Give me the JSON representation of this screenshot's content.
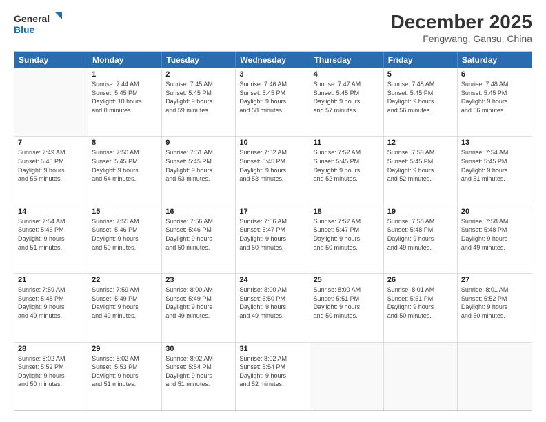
{
  "header": {
    "logo_line1": "General",
    "logo_line2": "Blue",
    "title": "December 2025",
    "subtitle": "Fengwang, Gansu, China"
  },
  "weekdays": [
    "Sunday",
    "Monday",
    "Tuesday",
    "Wednesday",
    "Thursday",
    "Friday",
    "Saturday"
  ],
  "weeks": [
    [
      {
        "day": "",
        "info": ""
      },
      {
        "day": "1",
        "info": "Sunrise: 7:44 AM\nSunset: 5:45 PM\nDaylight: 10 hours\nand 0 minutes."
      },
      {
        "day": "2",
        "info": "Sunrise: 7:45 AM\nSunset: 5:45 PM\nDaylight: 9 hours\nand 59 minutes."
      },
      {
        "day": "3",
        "info": "Sunrise: 7:46 AM\nSunset: 5:45 PM\nDaylight: 9 hours\nand 58 minutes."
      },
      {
        "day": "4",
        "info": "Sunrise: 7:47 AM\nSunset: 5:45 PM\nDaylight: 9 hours\nand 57 minutes."
      },
      {
        "day": "5",
        "info": "Sunrise: 7:48 AM\nSunset: 5:45 PM\nDaylight: 9 hours\nand 56 minutes."
      },
      {
        "day": "6",
        "info": "Sunrise: 7:48 AM\nSunset: 5:45 PM\nDaylight: 9 hours\nand 56 minutes."
      }
    ],
    [
      {
        "day": "7",
        "info": "Sunrise: 7:49 AM\nSunset: 5:45 PM\nDaylight: 9 hours\nand 55 minutes."
      },
      {
        "day": "8",
        "info": "Sunrise: 7:50 AM\nSunset: 5:45 PM\nDaylight: 9 hours\nand 54 minutes."
      },
      {
        "day": "9",
        "info": "Sunrise: 7:51 AM\nSunset: 5:45 PM\nDaylight: 9 hours\nand 53 minutes."
      },
      {
        "day": "10",
        "info": "Sunrise: 7:52 AM\nSunset: 5:45 PM\nDaylight: 9 hours\nand 53 minutes."
      },
      {
        "day": "11",
        "info": "Sunrise: 7:52 AM\nSunset: 5:45 PM\nDaylight: 9 hours\nand 52 minutes."
      },
      {
        "day": "12",
        "info": "Sunrise: 7:53 AM\nSunset: 5:45 PM\nDaylight: 9 hours\nand 52 minutes."
      },
      {
        "day": "13",
        "info": "Sunrise: 7:54 AM\nSunset: 5:45 PM\nDaylight: 9 hours\nand 51 minutes."
      }
    ],
    [
      {
        "day": "14",
        "info": "Sunrise: 7:54 AM\nSunset: 5:46 PM\nDaylight: 9 hours\nand 51 minutes."
      },
      {
        "day": "15",
        "info": "Sunrise: 7:55 AM\nSunset: 5:46 PM\nDaylight: 9 hours\nand 50 minutes."
      },
      {
        "day": "16",
        "info": "Sunrise: 7:56 AM\nSunset: 5:46 PM\nDaylight: 9 hours\nand 50 minutes."
      },
      {
        "day": "17",
        "info": "Sunrise: 7:56 AM\nSunset: 5:47 PM\nDaylight: 9 hours\nand 50 minutes."
      },
      {
        "day": "18",
        "info": "Sunrise: 7:57 AM\nSunset: 5:47 PM\nDaylight: 9 hours\nand 50 minutes."
      },
      {
        "day": "19",
        "info": "Sunrise: 7:58 AM\nSunset: 5:48 PM\nDaylight: 9 hours\nand 49 minutes."
      },
      {
        "day": "20",
        "info": "Sunrise: 7:58 AM\nSunset: 5:48 PM\nDaylight: 9 hours\nand 49 minutes."
      }
    ],
    [
      {
        "day": "21",
        "info": "Sunrise: 7:59 AM\nSunset: 5:48 PM\nDaylight: 9 hours\nand 49 minutes."
      },
      {
        "day": "22",
        "info": "Sunrise: 7:59 AM\nSunset: 5:49 PM\nDaylight: 9 hours\nand 49 minutes."
      },
      {
        "day": "23",
        "info": "Sunrise: 8:00 AM\nSunset: 5:49 PM\nDaylight: 9 hours\nand 49 minutes."
      },
      {
        "day": "24",
        "info": "Sunrise: 8:00 AM\nSunset: 5:50 PM\nDaylight: 9 hours\nand 49 minutes."
      },
      {
        "day": "25",
        "info": "Sunrise: 8:00 AM\nSunset: 5:51 PM\nDaylight: 9 hours\nand 50 minutes."
      },
      {
        "day": "26",
        "info": "Sunrise: 8:01 AM\nSunset: 5:51 PM\nDaylight: 9 hours\nand 50 minutes."
      },
      {
        "day": "27",
        "info": "Sunrise: 8:01 AM\nSunset: 5:52 PM\nDaylight: 9 hours\nand 50 minutes."
      }
    ],
    [
      {
        "day": "28",
        "info": "Sunrise: 8:02 AM\nSunset: 5:52 PM\nDaylight: 9 hours\nand 50 minutes."
      },
      {
        "day": "29",
        "info": "Sunrise: 8:02 AM\nSunset: 5:53 PM\nDaylight: 9 hours\nand 51 minutes."
      },
      {
        "day": "30",
        "info": "Sunrise: 8:02 AM\nSunset: 5:54 PM\nDaylight: 9 hours\nand 51 minutes."
      },
      {
        "day": "31",
        "info": "Sunrise: 8:02 AM\nSunset: 5:54 PM\nDaylight: 9 hours\nand 52 minutes."
      },
      {
        "day": "",
        "info": ""
      },
      {
        "day": "",
        "info": ""
      },
      {
        "day": "",
        "info": ""
      }
    ]
  ]
}
